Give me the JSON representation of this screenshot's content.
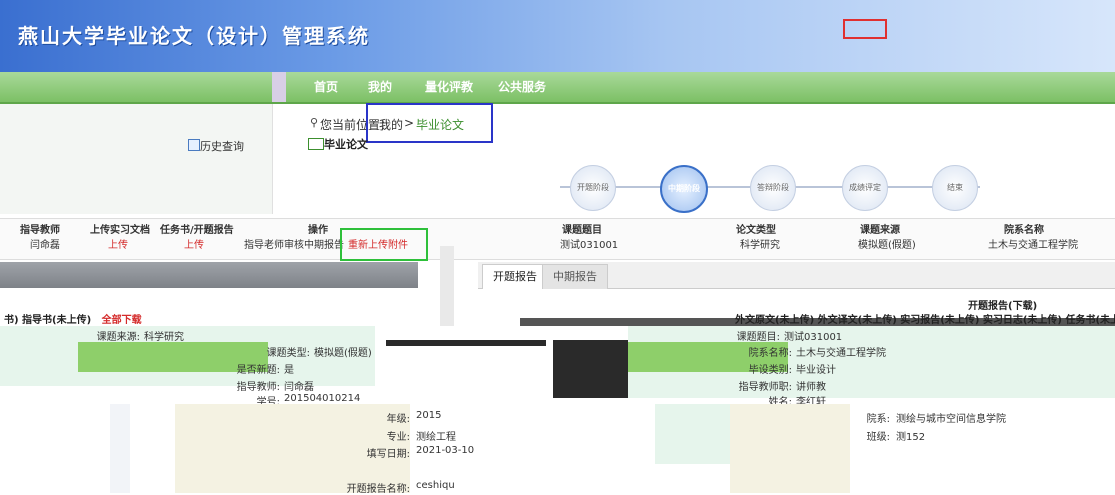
{
  "banner": {
    "title": "燕山大学毕业论文（设计）管理系统"
  },
  "nav": {
    "items": [
      "首页",
      "我的",
      "量化评教",
      "公共服务"
    ]
  },
  "sidebar": {
    "history_label": "历史查询"
  },
  "breadcrumb": {
    "prefix": "您当前位置：",
    "mine": "我的",
    "sep": ">",
    "current": "毕业论文"
  },
  "section": {
    "title": "毕业论文"
  },
  "steps": {
    "labels": [
      "开题阶段",
      "中期阶段",
      "答辩阶段",
      "成绩评定",
      "结束"
    ],
    "active_index": 1
  },
  "info": {
    "headers": [
      "指导教师",
      "上传实习文档",
      "任务书/开题报告",
      "操作",
      "课题题目",
      "论文类型",
      "课题来源",
      "院系名称"
    ],
    "values": [
      "闫命磊",
      "上传",
      "上传",
      "指导老师审核中期报告",
      "重新上传附件",
      "测试031001",
      "科学研究",
      "模拟题(假题)",
      "土木与交通工程学院"
    ]
  },
  "tabs": {
    "labels": [
      "开题报告",
      "中期报告"
    ],
    "active": 0
  },
  "doc": {
    "kaiti_download": "开题报告(下载)",
    "right_links": "外文原文(未上传)  外文译文(未上传)  实习报告(未上传)  实习日志(未上传)  任务书(未上",
    "left_links_prefix": "书)  指导书(未上传)",
    "left_download": "全部下载"
  },
  "left_form": {
    "rows": [
      {
        "label": "课题来源:",
        "value": "科学研究"
      },
      {
        "label": "课题类型:",
        "value": "模拟题(假题)"
      },
      {
        "label": "是否新题:",
        "value": "是"
      },
      {
        "label": "指导教师:",
        "value": "闫命磊"
      },
      {
        "label": "学号:",
        "value": "201504010214"
      }
    ]
  },
  "right_form": {
    "rows": [
      {
        "label": "课题题目:",
        "value": "测试031001"
      },
      {
        "label": "院系名称:",
        "value": "土木与交通工程学院"
      },
      {
        "label": "毕设类别:",
        "value": "毕业设计"
      },
      {
        "label": "指导教师职:",
        "value": "讲师教"
      },
      {
        "label": "姓名:",
        "value": "李红轩"
      }
    ]
  },
  "bottom_form": {
    "grade_label": "年级:",
    "grade": "2015",
    "major_label": "专业:",
    "major": "测绘工程",
    "date_label": "填写日期:",
    "date": "2021-03-10",
    "dept_label": "院系:",
    "dept": "测绘与城市空间信息学院",
    "class_label": "班级:",
    "class": "测152",
    "report_label": "开题报告名称:",
    "report": "ceshiqu"
  }
}
